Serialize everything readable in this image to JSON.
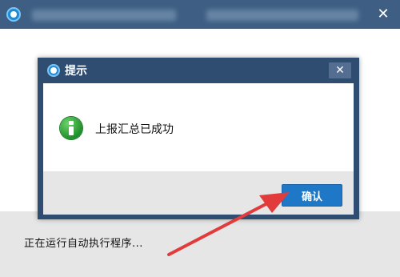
{
  "outer_window": {
    "close_glyph": "✕",
    "status_text": "正在运行自动执行程序..."
  },
  "dialog": {
    "title": "提示",
    "close_glyph": "✕",
    "message": "上报汇总已成功",
    "confirm_label": "确认",
    "icon": "info-icon"
  },
  "colors": {
    "titlebar": "#3e5f83",
    "dialog_frame": "#2f4d70",
    "confirm_button": "#1f77c8",
    "info_icon": "#1f8f2b",
    "annotation": "#e23b3b"
  }
}
